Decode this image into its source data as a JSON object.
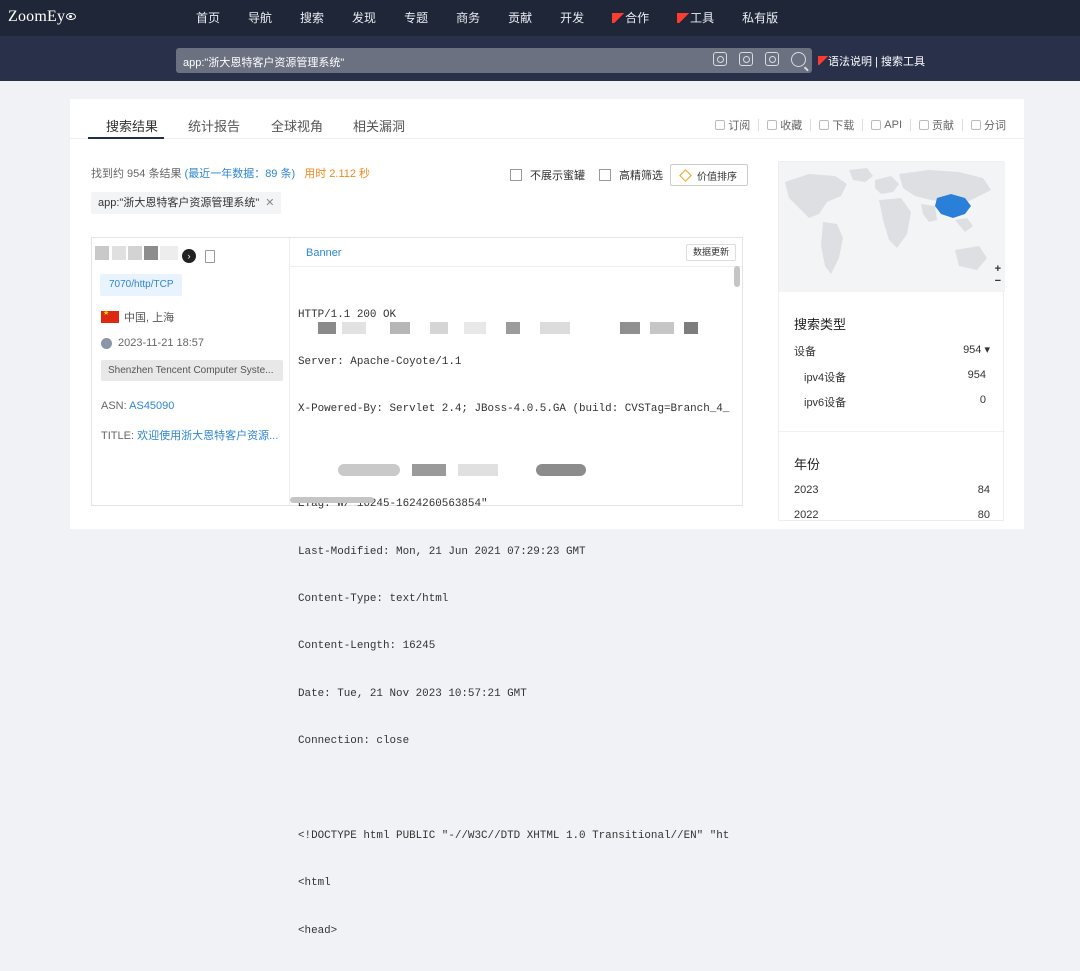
{
  "topbar": {
    "logo": "ZoomEy",
    "nav": [
      "首页",
      "导航",
      "搜索",
      "发现",
      "专题",
      "商务",
      "贡献",
      "开发",
      "合作",
      "工具",
      "私有版"
    ]
  },
  "search": {
    "query": "app:\"浙大恩特客户资源管理系统\"",
    "help_link": "语法说明 | 搜索工具"
  },
  "tabs": [
    "搜索结果",
    "统计报告",
    "全球视角",
    "相关漏洞"
  ],
  "actions": [
    "订阅",
    "收藏",
    "下载",
    "API",
    "贡献",
    "分词"
  ],
  "summary": {
    "found": "找到约 954 条结果",
    "recent": "(最近一年数据：89 条)",
    "elapsed": "用时 2.112 秒"
  },
  "filters": {
    "honeypot": "不展示蜜罐",
    "precise": "高精筛选",
    "sort": "价值排序"
  },
  "chip": "app:\"浙大恩特客户资源管理系统\"",
  "result": {
    "port_badge": "7070/http/TCP",
    "location": "中国, 上海",
    "timestamp": "2023-11-21 18:57",
    "org": "Shenzhen Tencent Computer Syste...",
    "asn_label": "ASN:",
    "asn_value": "AS45090",
    "title_label": "TITLE:",
    "title_value": "欢迎使用浙大恩特客户资源...",
    "banner_tab": "Banner",
    "update_button": "数据更新",
    "banner_lines": [
      "HTTP/1.1 200 OK",
      "Server: Apache-Coyote/1.1",
      "X-Powered-By: Servlet 2.4; JBoss-4.0.5.GA (build: CVSTag=Branch_4_",
      "",
      "ETag: W/\"16245-1624260563854\"",
      "Last-Modified: Mon, 21 Jun 2021 07:29:23 GMT",
      "Content-Type: text/html",
      "Content-Length: 16245",
      "Date: Tue, 21 Nov 2023 10:57:21 GMT",
      "Connection: close",
      "",
      "<!DOCTYPE html PUBLIC \"-//W3C//DTD XHTML 1.0 Transitional//EN\" \"ht",
      "<html",
      "<head>"
    ]
  },
  "sidebar": {
    "zoom_in": "+",
    "zoom_out": "−",
    "search_type_title": "搜索类型",
    "devices_label": "设备",
    "devices_value": "954 ▾",
    "ipv4_label": "ipv4设备",
    "ipv4_value": "954",
    "ipv6_label": "ipv6设备",
    "ipv6_value": "0",
    "year_title": "年份",
    "years": [
      {
        "label": "2023",
        "value": "84"
      },
      {
        "label": "2022",
        "value": "80"
      }
    ]
  },
  "colors": {
    "topbar_bg": "#1f2637",
    "accent_blue": "#2f86d3",
    "map_highlight": "#2a7fd9"
  }
}
